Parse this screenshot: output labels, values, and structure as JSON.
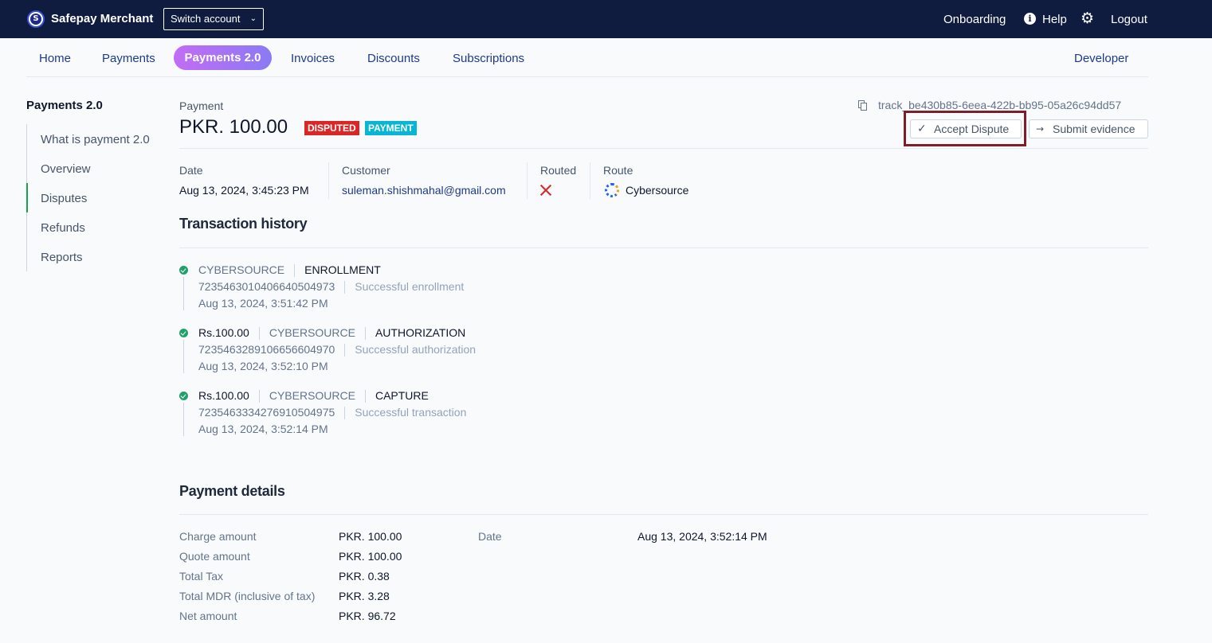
{
  "topbar": {
    "brand": "Safepay Merchant",
    "logo_letter": "S",
    "switch_account": "Switch account",
    "onboarding": "Onboarding",
    "help": "Help",
    "logout": "Logout"
  },
  "nav": {
    "home": "Home",
    "payments": "Payments",
    "payments2": "Payments 2.0",
    "invoices": "Invoices",
    "discounts": "Discounts",
    "subscriptions": "Subscriptions",
    "developer": "Developer"
  },
  "sidebar": {
    "title": "Payments 2.0",
    "items": [
      "What is payment 2.0",
      "Overview",
      "Disputes",
      "Refunds",
      "Reports"
    ],
    "active": "Disputes"
  },
  "payment": {
    "label": "Payment",
    "amount": "PKR. 100.00",
    "badges": [
      "DISPUTED",
      "PAYMENT"
    ],
    "tracker": "track_be430b85-6eea-422b-bb95-05a26c94dd57",
    "accept_dispute": "Accept Dispute",
    "submit_evidence": "Submit evidence"
  },
  "summary": {
    "date_label": "Date",
    "date_value": "Aug 13, 2024, 3:45:23 PM",
    "customer_label": "Customer",
    "customer_value": "suleman.shishmahal@gmail.com",
    "routed_label": "Routed",
    "route_label": "Route",
    "route_value": "Cybersource"
  },
  "history": {
    "title": "Transaction history",
    "events": [
      {
        "amount": "",
        "processor": "CYBERSOURCE",
        "type": "ENROLLMENT",
        "reference": "7235463010406640504973",
        "message": "Successful enrollment",
        "timestamp": "Aug 13, 2024, 3:51:42 PM"
      },
      {
        "amount": "Rs.100.00",
        "processor": "CYBERSOURCE",
        "type": "AUTHORIZATION",
        "reference": "7235463289106656604970",
        "message": "Successful authorization",
        "timestamp": "Aug 13, 2024, 3:52:10 PM"
      },
      {
        "amount": "Rs.100.00",
        "processor": "CYBERSOURCE",
        "type": "CAPTURE",
        "reference": "7235463334276910504975",
        "message": "Successful transaction",
        "timestamp": "Aug 13, 2024, 3:52:14 PM"
      }
    ]
  },
  "details": {
    "title": "Payment details",
    "rows": [
      {
        "label": "Charge amount",
        "value": "PKR. 100.00"
      },
      {
        "label": "Quote amount",
        "value": "PKR. 100.00"
      },
      {
        "label": "Total Tax",
        "value": "PKR. 0.38"
      },
      {
        "label": "Total MDR (inclusive of tax)",
        "value": "PKR. 3.28"
      },
      {
        "label": "Net amount",
        "value": "PKR. 96.72"
      }
    ],
    "date_label": "Date",
    "date_value": "Aug 13, 2024, 3:52:14 PM"
  }
}
